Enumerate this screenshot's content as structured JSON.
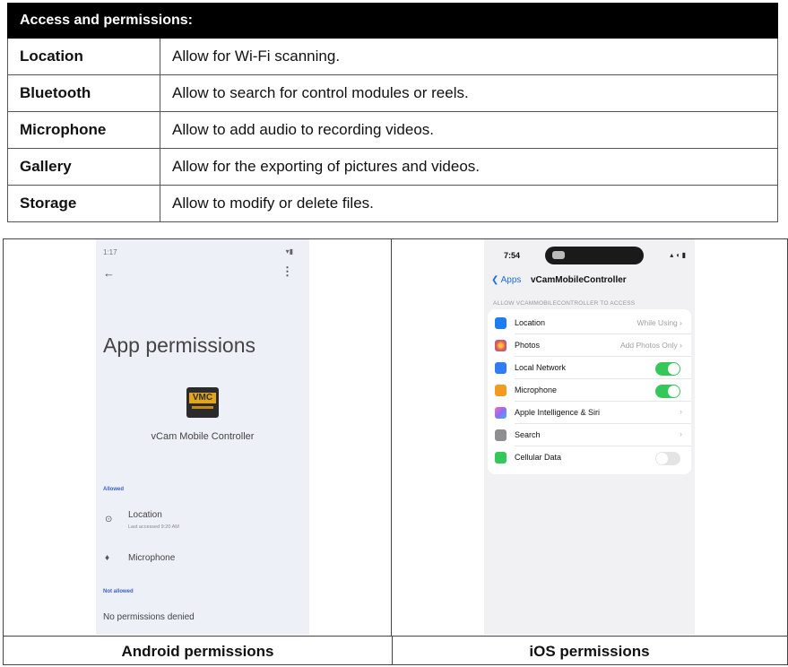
{
  "table": {
    "header": "Access and permissions:",
    "rows": [
      {
        "name": "Location",
        "desc": "Allow for Wi-Fi scanning."
      },
      {
        "name": "Bluetooth",
        "desc": "Allow to search for control modules or reels."
      },
      {
        "name": "Microphone",
        "desc": "Allow to add audio to recording videos."
      },
      {
        "name": "Gallery",
        "desc": "Allow for the exporting of pictures and videos."
      },
      {
        "name": "Storage",
        "desc": "Allow to modify or delete files."
      }
    ]
  },
  "android": {
    "status_time": "1:17",
    "title": "App permissions",
    "logo_text": "VMC",
    "app_name": "vCam Mobile Controller",
    "allowed_label": "Allowed",
    "location_label": "Location",
    "location_sub": "Last accessed 9:20 AM",
    "microphone_label": "Microphone",
    "not_allowed_label": "Not allowed",
    "none_label": "No permissions denied",
    "caption": "Android permissions"
  },
  "ios": {
    "time": "7:54",
    "back_label": "Apps",
    "nav_title": "vCamMobileController",
    "section_header": "ALLOW VCAMMOBILECONTROLLER TO ACCESS",
    "rows": [
      {
        "label": "Location",
        "value": "While Using",
        "icon_color": "#1e7cf2"
      },
      {
        "label": "Photos",
        "value": "Add Photos Only",
        "icon_color": "#f0883a"
      },
      {
        "label": "Local Network",
        "toggle": "on",
        "icon_color": "#2f7cf6"
      },
      {
        "label": "Microphone",
        "toggle": "on",
        "icon_color": "#f39b20"
      },
      {
        "label": "Apple Intelligence & Siri",
        "icon_color": "#c059d8"
      },
      {
        "label": "Search",
        "icon_color": "#8e8e93"
      },
      {
        "label": "Cellular Data",
        "toggle": "off",
        "icon_color": "#34c759"
      }
    ],
    "caption": "iOS permissions"
  }
}
